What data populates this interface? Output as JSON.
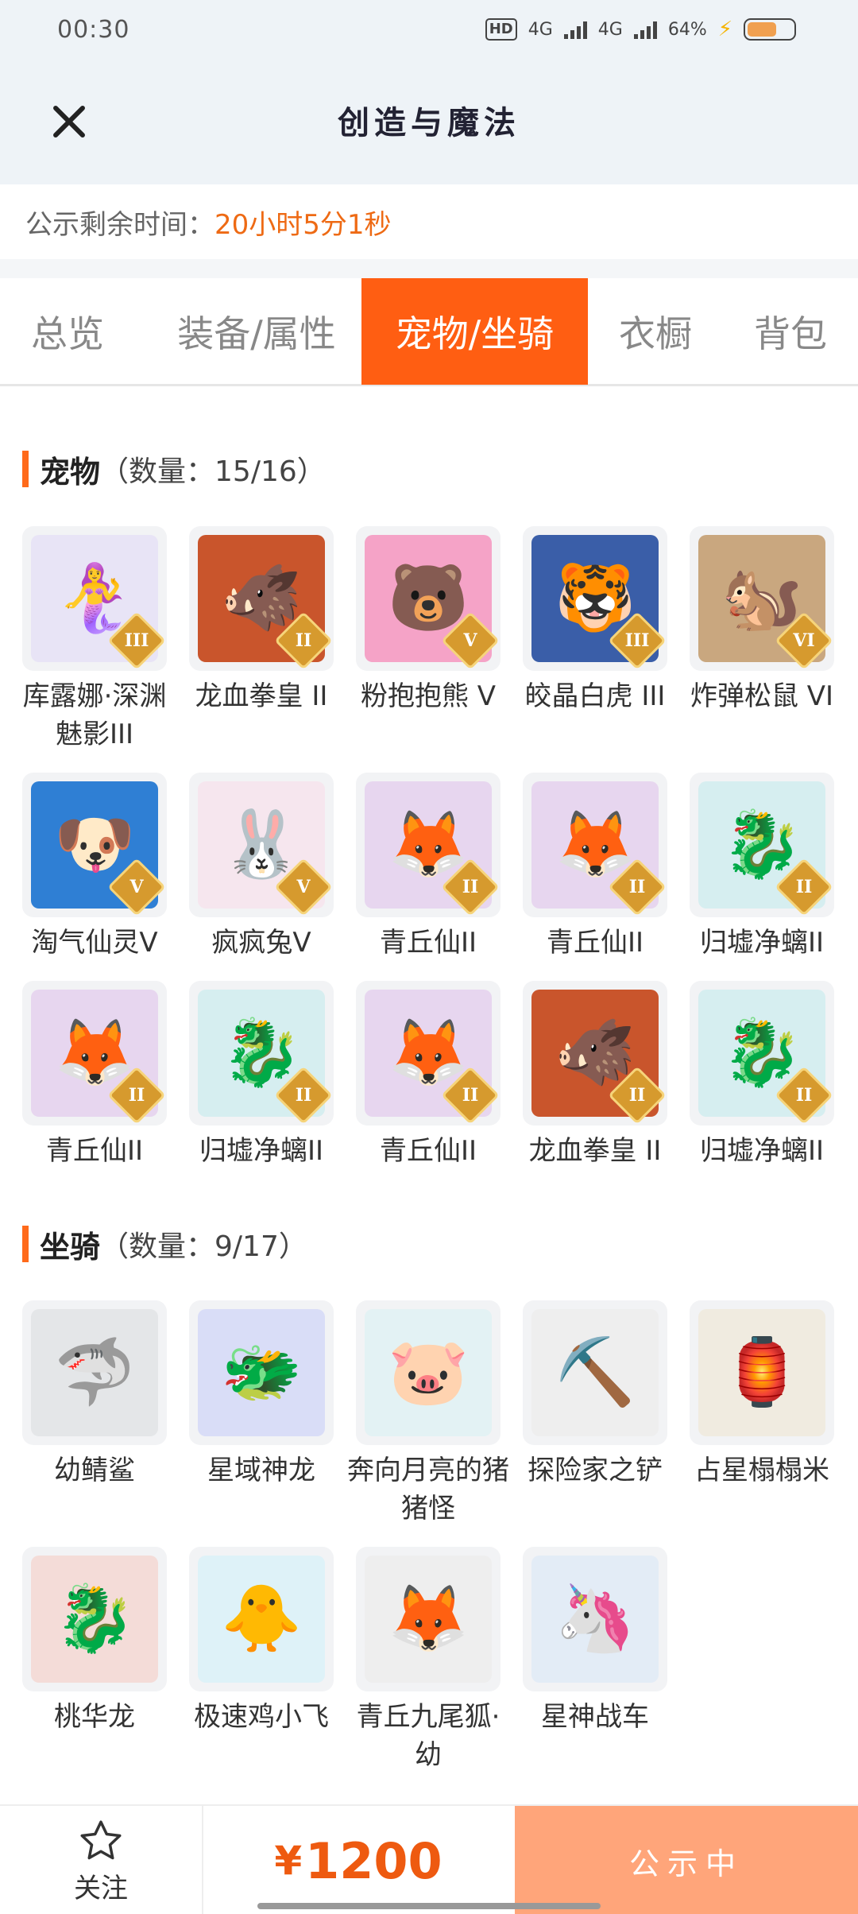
{
  "status_bar": {
    "time": "00:30",
    "hd_badge": "HD",
    "net1": "4G",
    "net2": "4G",
    "battery": "64%"
  },
  "header": {
    "title": "创造与魔法",
    "close_icon": "close-icon"
  },
  "notice": {
    "label": "公示剩余时间：",
    "time": "20小时5分1秒"
  },
  "tabs": [
    {
      "label": "总览"
    },
    {
      "label": "装备/属性"
    },
    {
      "label": "宠物/坐骑",
      "active": true
    },
    {
      "label": "衣橱"
    },
    {
      "label": "背包"
    }
  ],
  "pets": {
    "title": "宠物",
    "count": "（数量：15/16）",
    "items": [
      {
        "name": "库露娜·深渊魅影III",
        "rank": "III",
        "icon": "🧜‍♀️",
        "bg": "#e8e4f6"
      },
      {
        "name": "龙血拳皇 II",
        "rank": "II",
        "icon": "🐗",
        "bg": "#c9552c"
      },
      {
        "name": "粉抱抱熊 V",
        "rank": "V",
        "icon": "🐻",
        "bg": "#f5a3c7"
      },
      {
        "name": "皎晶白虎 III",
        "rank": "III",
        "icon": "🐯",
        "bg": "#3a5ea8"
      },
      {
        "name": "炸弹松鼠 VI",
        "rank": "VI",
        "icon": "🐿️",
        "bg": "#c9a77f"
      },
      {
        "name": "淘气仙灵V",
        "rank": "V",
        "icon": "🐶",
        "bg": "#2f7fd4"
      },
      {
        "name": "疯疯兔V",
        "rank": "V",
        "icon": "🐰",
        "bg": "#f6e6ee"
      },
      {
        "name": "青丘仙II",
        "rank": "II",
        "icon": "🦊",
        "bg": "#e7d6ef"
      },
      {
        "name": "青丘仙II",
        "rank": "II",
        "icon": "🦊",
        "bg": "#e7d6ef"
      },
      {
        "name": "归墟净螭II",
        "rank": "II",
        "icon": "🐉",
        "bg": "#d6eef0"
      },
      {
        "name": "青丘仙II",
        "rank": "II",
        "icon": "🦊",
        "bg": "#e7d6ef"
      },
      {
        "name": "归墟净螭II",
        "rank": "II",
        "icon": "🐉",
        "bg": "#d6eef0"
      },
      {
        "name": "青丘仙II",
        "rank": "II",
        "icon": "🦊",
        "bg": "#e7d6ef"
      },
      {
        "name": "龙血拳皇 II",
        "rank": "II",
        "icon": "🐗",
        "bg": "#c9552c"
      },
      {
        "name": "归墟净螭II",
        "rank": "II",
        "icon": "🐉",
        "bg": "#d6eef0"
      }
    ]
  },
  "mounts": {
    "title": "坐骑",
    "count": "（数量：9/17）",
    "items": [
      {
        "name": "幼鲭鲨",
        "icon": "🦈",
        "bg": "#e4e6e8"
      },
      {
        "name": "星域神龙",
        "icon": "🐲",
        "bg": "#d9ddf7"
      },
      {
        "name": "奔向月亮的猪猪怪",
        "icon": "🐷",
        "bg": "#e3f2f4"
      },
      {
        "name": "探险家之铲",
        "icon": "⛏️",
        "bg": "#eeeeee"
      },
      {
        "name": "占星榻榻米",
        "icon": "🏮",
        "bg": "#f0ebe0"
      },
      {
        "name": "桃华龙",
        "icon": "🐉",
        "bg": "#f4dcd8"
      },
      {
        "name": "极速鸡小飞",
        "icon": "🐥",
        "bg": "#def2f8"
      },
      {
        "name": "青丘九尾狐·幼",
        "icon": "🦊",
        "bg": "#eeeeee"
      },
      {
        "name": "星神战车",
        "icon": "🦄",
        "bg": "#e3ecf6"
      }
    ]
  },
  "bottom": {
    "follow_label": "关注",
    "currency": "¥",
    "price": "1200",
    "status_label": "公示中"
  },
  "colors": {
    "accent": "#ff5e12",
    "price": "#ee5a10",
    "status_bg": "#ffa57a"
  }
}
